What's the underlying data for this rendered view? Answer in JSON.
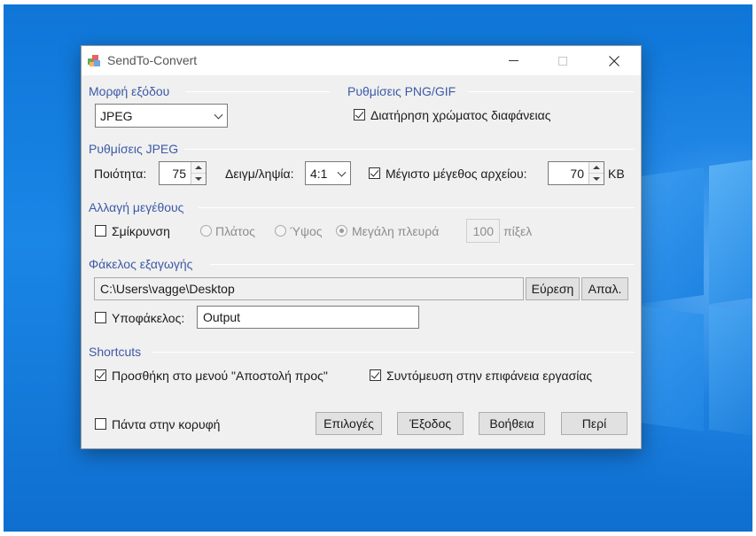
{
  "window": {
    "title": "SendTo-Convert"
  },
  "output_format": {
    "title": "Μορφή εξόδου",
    "selected": "JPEG"
  },
  "png_gif": {
    "title": "Ρυθμίσεις PNG/GIF",
    "preserve_transparency_label": "Διατήρηση χρώματος διαφάνειας",
    "preserve_transparency_checked": true
  },
  "jpeg": {
    "title": "Ρυθμίσεις JPEG",
    "quality_label": "Ποιότητα:",
    "quality_value": "75",
    "sampling_label": "Δειγμ/ληψία:",
    "sampling_value": "4:1",
    "max_size_label": "Μέγιστο μέγεθος αρχείου:",
    "max_size_checked": true,
    "max_size_value": "70",
    "max_size_unit": "KB"
  },
  "resize": {
    "title": "Αλλαγή μεγέθους",
    "shrink_label": "Σμίκρυνση",
    "shrink_checked": false,
    "width_label": "Πλάτος",
    "height_label": "Ύψος",
    "long_side_label": "Μεγάλη πλευρά",
    "long_side_selected": true,
    "pixels_value": "100",
    "pixels_unit": "πίξελ"
  },
  "export": {
    "title": "Φάκελος εξαγωγής",
    "path": "C:\\Users\\vagge\\Desktop",
    "browse_label": "Εύρεση",
    "clear_label": "Απαλ.",
    "subfolder_label": "Υποφάκελος:",
    "subfolder_checked": false,
    "subfolder_value": "Output"
  },
  "shortcuts": {
    "title": "Shortcuts",
    "sendto_label": "Προσθήκη στο μενού \"Αποστολή προς\"",
    "sendto_checked": true,
    "desktop_label": "Συντόμευση στην επιφάνεια εργασίας",
    "desktop_checked": true
  },
  "footer": {
    "always_on_top_label": "Πάντα στην κορυφή",
    "always_on_top_checked": false,
    "options_label": "Επιλογές",
    "exit_label": "Έξοδος",
    "help_label": "Βοήθεια",
    "about_label": "Περί"
  },
  "colors": {
    "section_title": "#3d5aa8",
    "desktop": "#1a86e6",
    "window_bg": "#f0f0f0"
  }
}
